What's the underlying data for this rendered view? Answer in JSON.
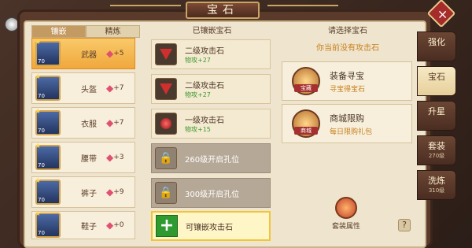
{
  "window": {
    "title": "宝石"
  },
  "left": {
    "tabs": [
      "镶嵌",
      "精炼"
    ],
    "items": [
      {
        "name": "武器",
        "count": "+5",
        "lv": "70"
      },
      {
        "name": "头盔",
        "count": "+7",
        "lv": "70"
      },
      {
        "name": "衣服",
        "count": "+7",
        "lv": "70"
      },
      {
        "name": "腰带",
        "count": "+3",
        "lv": "70"
      },
      {
        "name": "裤子",
        "count": "+9",
        "lv": "70"
      },
      {
        "name": "鞋子",
        "count": "+0",
        "lv": "70"
      }
    ]
  },
  "middle": {
    "header": "已镶嵌宝石",
    "slots": [
      {
        "name": "二级攻击石",
        "stat": "物攻+27"
      },
      {
        "name": "二级攻击石",
        "stat": "物攻+27"
      },
      {
        "name": "一级攻击石",
        "stat": "物攻+15"
      }
    ],
    "locked": [
      "260级开启孔位",
      "300级开启孔位"
    ],
    "add_label": "可镶嵌攻击石"
  },
  "right": {
    "header": "请选择宝石",
    "note": "你当前没有攻击石",
    "cards": [
      {
        "title": "装备寻宝",
        "sub": "寻宝得宝石",
        "tag": "宝藏"
      },
      {
        "title": "商城限购",
        "sub": "每日限购礼包",
        "tag": "商城"
      }
    ],
    "suit_label": "套装属性",
    "help": "?"
  },
  "side_tabs": [
    {
      "label": "强化",
      "sub": ""
    },
    {
      "label": "宝石",
      "sub": ""
    },
    {
      "label": "升星",
      "sub": ""
    },
    {
      "label": "套装",
      "sub": "270级"
    },
    {
      "label": "洗炼",
      "sub": "310级"
    }
  ]
}
